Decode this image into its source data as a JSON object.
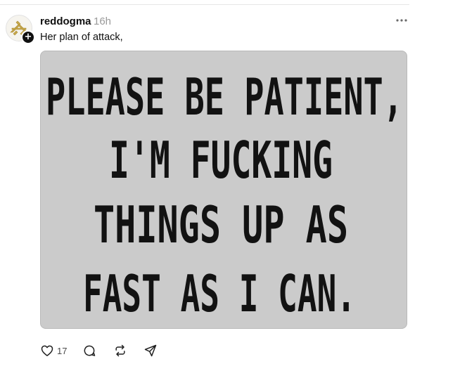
{
  "post": {
    "username": "reddogma",
    "timestamp": "16h",
    "caption": "Her plan of attack,",
    "follow_badge": "+",
    "image": {
      "lines": [
        "PLEASE BE PATIENT,",
        "I'M FUCKING",
        "THINGS UP AS",
        "FAST AS I CAN."
      ],
      "background_color": "#cbcbcb",
      "text_color": "#121212"
    },
    "actions": {
      "like_count": "17",
      "icons": [
        "heart-icon",
        "comment-icon",
        "repost-icon",
        "share-icon"
      ]
    }
  }
}
